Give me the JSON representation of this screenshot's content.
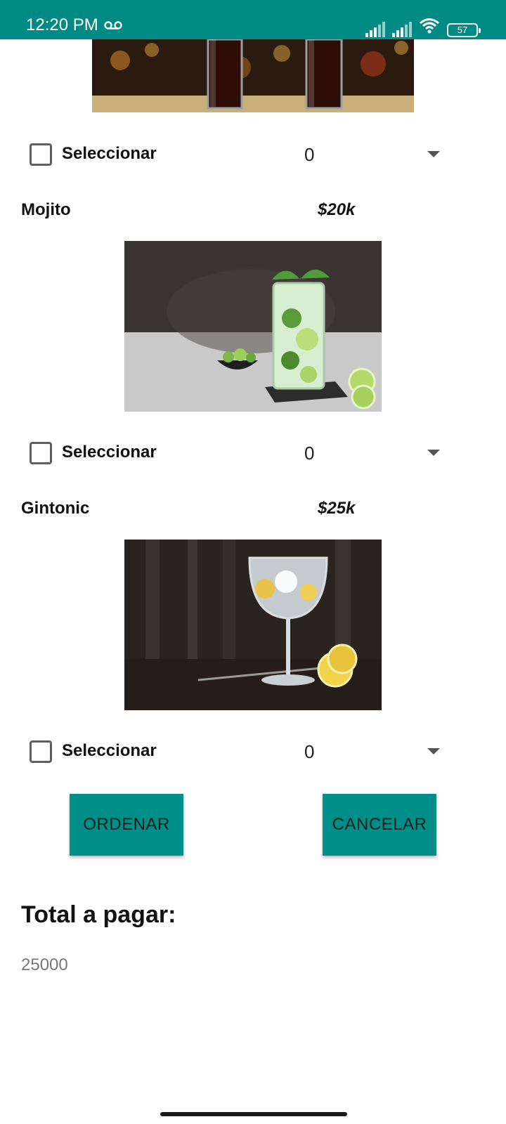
{
  "status_bar": {
    "time": "12:20 PM",
    "battery": "57"
  },
  "items": [
    {
      "selector_label": "Seleccionar",
      "quantity": "0"
    },
    {
      "name": "Mojito",
      "price": "$20k",
      "selector_label": "Seleccionar",
      "quantity": "0"
    },
    {
      "name": "Gintonic",
      "price": "$25k",
      "selector_label": "Seleccionar",
      "quantity": "0"
    }
  ],
  "buttons": {
    "order": "ORDENAR",
    "cancel": "CANCELAR"
  },
  "total": {
    "label": "Total a pagar:",
    "value": "25000"
  },
  "colors": {
    "accent": "#008a84",
    "button": "#008f88"
  }
}
